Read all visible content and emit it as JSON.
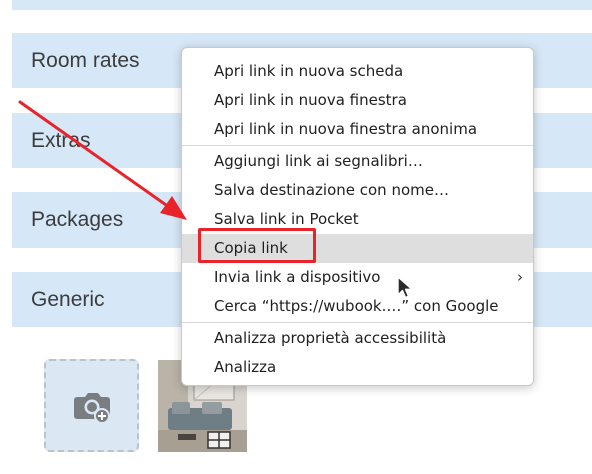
{
  "sections": {
    "room_rates": "Room rates",
    "extras": "Extras",
    "packages": "Packages",
    "generic": "Generic"
  },
  "icons": {
    "upload": "camera-plus-icon",
    "submenu": "chevron-right-icon",
    "cursor": "mouse-pointer-icon",
    "annotation": "red-arrow-icon"
  },
  "colors": {
    "section_bg": "#d6e8f7",
    "menu_highlight": "#dedede",
    "annotation_red": "#e8232a"
  },
  "context_menu": {
    "items": [
      {
        "label": "Apri link in nuova scheda"
      },
      {
        "label": "Apri link in nuova finestra"
      },
      {
        "label": "Apri link in nuova finestra anonima"
      },
      {
        "label": "Aggiungi link ai segnalibri…"
      },
      {
        "label": "Salva destinazione con nome…"
      },
      {
        "label": "Salva link in Pocket"
      },
      {
        "label": "Copia link"
      },
      {
        "label": "Invia link a dispositivo"
      },
      {
        "label": "Cerca “https://wubook.…” con Google"
      },
      {
        "label": "Analizza proprietà accessibilità"
      },
      {
        "label": "Analizza"
      }
    ],
    "submenu_glyph": "›"
  }
}
